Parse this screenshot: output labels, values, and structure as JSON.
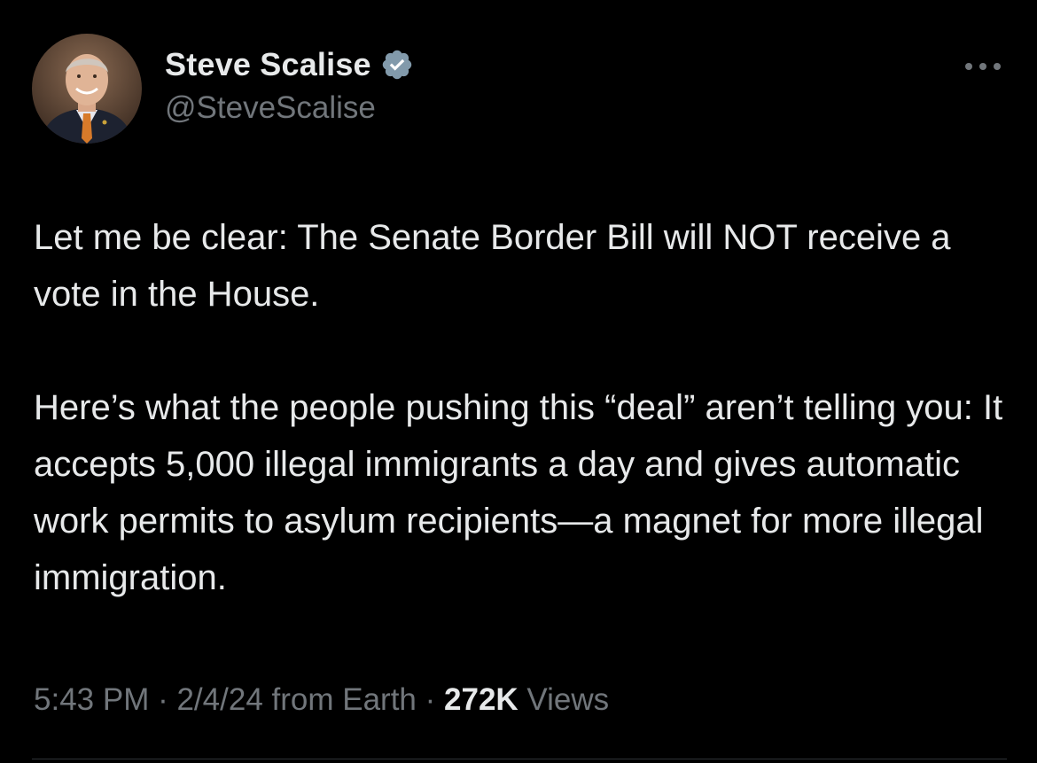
{
  "author": {
    "display_name": "Steve Scalise",
    "handle": "@SteveScalise",
    "verified": true,
    "avatar_icon": "profile-photo"
  },
  "more_icon": "more-horizontal-icon",
  "tweet": {
    "paragraphs": [
      "Let me be clear: The Senate Border Bill will NOT receive a vote in the House.",
      "Here’s what the people pushing this “deal” aren’t telling you: It accepts 5,000 illegal immigrants a day and gives automatic work permits to asylum recipients—a magnet for more illegal immigration."
    ]
  },
  "meta": {
    "time": "5:43 PM",
    "separator": " · ",
    "date": "2/4/24",
    "source": "from Earth",
    "views_count": "272K",
    "views_label": "Views"
  },
  "colors": {
    "background": "#000000",
    "text": "#e7e9ea",
    "secondary_text": "#71767b",
    "verified_badge": "#829aab"
  }
}
